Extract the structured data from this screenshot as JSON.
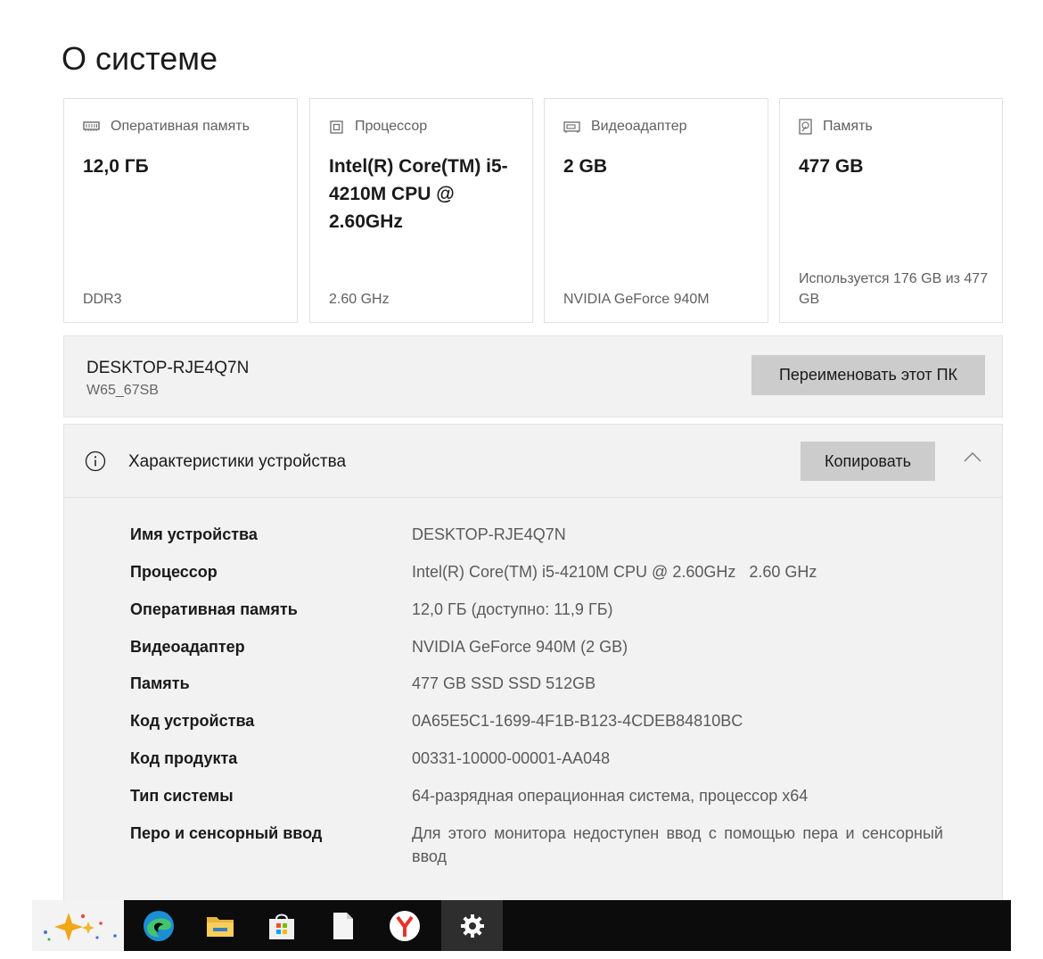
{
  "page": {
    "title": "О системе"
  },
  "cards": [
    {
      "icon": "ram-icon",
      "label": "Оперативная память",
      "value": "12,0 ГБ",
      "footer": "DDR3"
    },
    {
      "icon": "processor-icon",
      "label": "Процессор",
      "value": "Intel(R) Core(TM) i5-4210M CPU @ 2.60GHz",
      "footer": "2.60 GHz"
    },
    {
      "icon": "video-adapter-icon",
      "label": "Видеоадаптер",
      "value": "2 GB",
      "footer": "NVIDIA GeForce 940M"
    },
    {
      "icon": "storage-icon",
      "label": "Память",
      "value": "477 GB",
      "footer": "Используется 176 GB из 477 GB"
    }
  ],
  "pc": {
    "name": "DESKTOP-RJE4Q7N",
    "model": "W65_67SB",
    "rename_label": "Переименовать этот ПК"
  },
  "specs": {
    "title": "Характеристики устройства",
    "copy_label": "Копировать",
    "rows": [
      {
        "label": "Имя устройства",
        "value": "DESKTOP-RJE4Q7N"
      },
      {
        "label": "Процессор",
        "value": "Intel(R) Core(TM) i5-4210M CPU @ 2.60GHz   2.60 GHz"
      },
      {
        "label": "Оперативная память",
        "value": "12,0 ГБ (доступно: 11,9 ГБ)"
      },
      {
        "label": "Видеоадаптер",
        "value": "NVIDIA GeForce 940M (2 GB)"
      },
      {
        "label": "Память",
        "value": "477 GB SSD SSD 512GB"
      },
      {
        "label": "Код устройства",
        "value": "0A65E5C1-1699-4F1B-B123-4CDEB84810BC"
      },
      {
        "label": "Код продукта",
        "value": "00331-10000-00001-AA048"
      },
      {
        "label": "Тип системы",
        "value": "64-разрядная операционная система, процессор x64"
      },
      {
        "label": "Перо и сенсорный ввод",
        "value": "Для этого монитора недоступен ввод с помощью пера и сенсорный ввод"
      }
    ]
  },
  "taskbar": {
    "items": [
      "copilot-icon",
      "edge-icon",
      "file-explorer-icon",
      "store-icon",
      "notepad-icon",
      "yandex-browser-icon",
      "settings-icon"
    ]
  },
  "colors": {
    "panel_bg": "#f2f2f2",
    "button_bg": "#cccccc",
    "taskbar_bg": "#0c0c0c"
  }
}
